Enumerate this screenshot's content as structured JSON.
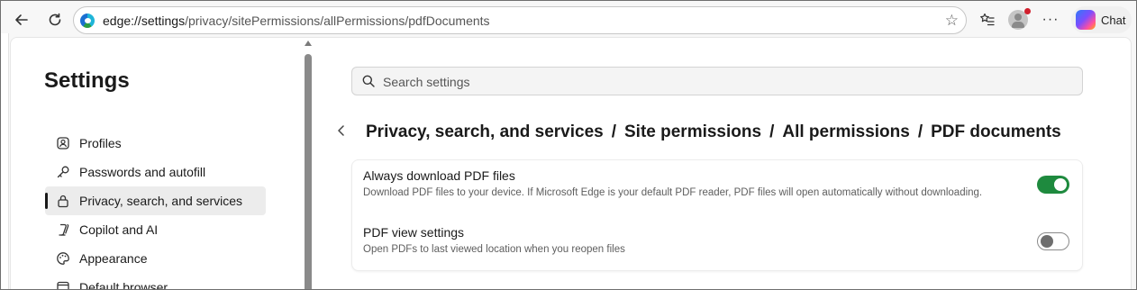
{
  "toolbar": {
    "url_prefix": "edge://",
    "url_host": "settings",
    "url_path": "/privacy/sitePermissions/allPermissions/pdfDocuments",
    "chat_label": "Chat"
  },
  "nav": {
    "title": "Settings",
    "items": [
      {
        "label": "Profiles",
        "icon": "profile-icon"
      },
      {
        "label": "Passwords and autofill",
        "icon": "key-icon"
      },
      {
        "label": "Privacy, search, and services",
        "icon": "lock-icon",
        "active": true
      },
      {
        "label": "Copilot and AI",
        "icon": "copilot-icon"
      },
      {
        "label": "Appearance",
        "icon": "palette-icon"
      },
      {
        "label": "Default browser",
        "icon": "browser-icon"
      }
    ]
  },
  "search": {
    "placeholder": "Search settings"
  },
  "breadcrumb": {
    "parts": [
      "Privacy, search, and services",
      "All permissions",
      "Site permissions",
      "PDF documents"
    ],
    "p1": "Privacy, search, and services",
    "p2": "Site permissions",
    "p3": "All permissions",
    "p4": "PDF documents",
    "sep": "/"
  },
  "settings": [
    {
      "title": "Always download PDF files",
      "description": "Download PDF files to your device. If Microsoft Edge is your default PDF reader, PDF files will open automatically without downloading.",
      "enabled": true
    },
    {
      "title": "PDF view settings",
      "description": "Open PDFs to last viewed location when you reopen files",
      "enabled": false
    }
  ],
  "colors": {
    "toggle_on": "#1e8a3e",
    "accent_active_bar": "#1a1a1a",
    "notification_dot": "#d1202e"
  }
}
